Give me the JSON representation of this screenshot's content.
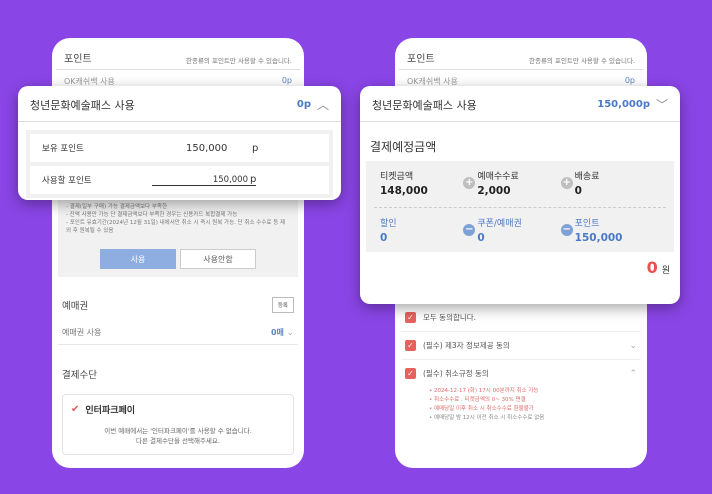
{
  "left_phone": {
    "points_section": {
      "title": "포인트",
      "note": "한종류의 포인트만 사용할 수 있습니다."
    },
    "ok_cashbag": {
      "label": "OK캐쉬백 사용",
      "value": "0p"
    },
    "notes": [
      "- 결제(일부 구매) 가능 결제금액보다 부족한",
      "- 잔액 사용만 가능 단 결제금액보다 부족한 경우는 신용카드 복합결제 가능",
      "- 포인트 유효기간(2024년 12월 31일) 내에서만 취소 시 즉시 원복 가능. 단 취소 수수료 등 제외 후 원복될 수 있음"
    ],
    "buttons": {
      "use": "사용",
      "no_use": "사용안함"
    },
    "voucher": {
      "title": "예매권",
      "register": "등록",
      "use_label": "예매권 사용",
      "value": "0매"
    },
    "payment": {
      "title": "결제수단",
      "method": "인터파크페이",
      "message_line1": "이번 예매에서는 '인터파크페이'를 사용할 수 없습니다.",
      "message_line2": "다른 결제수단을 선택해주세요."
    }
  },
  "popup_left": {
    "title": "청년문화예술패스 사용",
    "value": "0p",
    "held_label": "보유 포인트",
    "held_value": "150,000",
    "held_unit": "p",
    "use_label": "사용할 포인트",
    "use_value": "150,000",
    "use_unit": "p"
  },
  "right_phone": {
    "points_section": {
      "title": "포인트",
      "note": "한종류의 포인트만 사용할 수 있습니다."
    },
    "ok_cashbag": {
      "label": "OK캐쉬백 사용",
      "value": "0p"
    },
    "agree_all": "모두 동의합니다.",
    "agree_third": "(필수) 제3자 정보제공 동의",
    "agree_cancel": "(필수) 취소규정 동의",
    "cancel_notes": [
      "• 2024-12-17 (화) 17시 00분까지 취소 가능",
      "• 취소수수료 : 티켓금액의 0~ 30% 면결",
      "• 예매당일 이후 취소 시 취소수수료 환불불가",
      "• 예매당일 밤 12시 이전 취소 시 취소수수료 없음"
    ]
  },
  "popup_right": {
    "title": "청년문화예술패스 사용",
    "value": "150,000p",
    "expected_title": "결제예정금액",
    "items_row1": [
      {
        "label": "티켓금액",
        "value": "148,000"
      },
      {
        "label": "예매수수료",
        "value": "2,000"
      },
      {
        "label": "배송료",
        "value": "0"
      }
    ],
    "items_row2": [
      {
        "label": "할인",
        "value": "0"
      },
      {
        "label": "쿠폰/예매권",
        "value": "0"
      },
      {
        "label": "포인트",
        "value": "150,000"
      }
    ],
    "total": "0",
    "total_unit": "원"
  }
}
